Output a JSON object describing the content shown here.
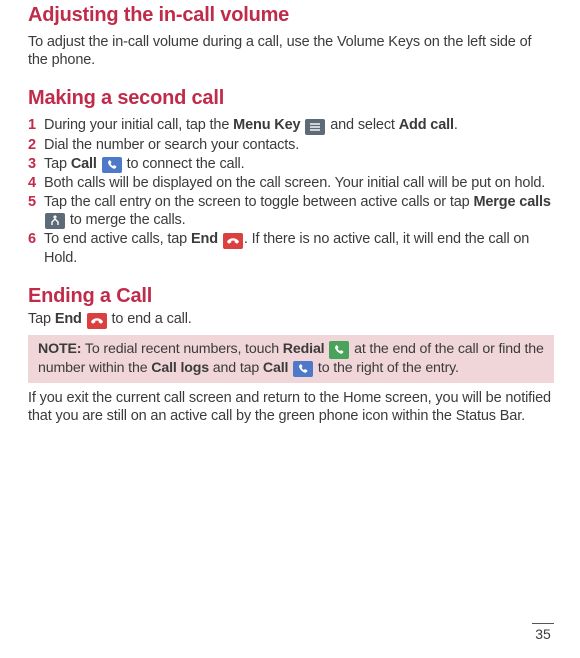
{
  "adjusting": {
    "heading": "Adjusting the in-call volume",
    "body": "To adjust the in-call volume during a call, use the Volume Keys on the left side of the phone."
  },
  "making": {
    "heading": "Making a second call",
    "steps": {
      "s1a": "During your initial call, tap the ",
      "s1b": "Menu Key",
      "s1c": " and select ",
      "s1d": "Add call",
      "s1e": ".",
      "s2": "Dial the number or search your contacts.",
      "s3a": "Tap ",
      "s3b": "Call",
      "s3c": " to connect the call.",
      "s4": "Both calls will be displayed on the call screen. Your initial call will be put on hold.",
      "s5a": "Tap the call entry on the screen to toggle between active calls or tap ",
      "s5b": "Merge calls",
      "s5c": " to merge the calls.",
      "s6a": "To end active calls, tap ",
      "s6b": "End",
      "s6c": ". If there is no active call, it will end the call on Hold."
    },
    "nums": {
      "n1": "1",
      "n2": "2",
      "n3": "3",
      "n4": "4",
      "n5": "5",
      "n6": "6"
    }
  },
  "ending": {
    "heading": "Ending a Call",
    "body_a": "Tap ",
    "body_b": "End",
    "body_c": " to end a call.",
    "note_label": "NOTE:",
    "note_a": " To redial recent numbers, touch ",
    "note_b": "Redial",
    "note_c": " at the end of the call or find the number within the ",
    "note_d": "Call logs",
    "note_e": " and tap ",
    "note_f": "Call",
    "note_g": " to the right of the entry.",
    "closing": "If you exit the current call screen and return to the Home screen, you will be notified that you are still on an active call by the green phone icon within the Status Bar."
  },
  "page_number": "35"
}
